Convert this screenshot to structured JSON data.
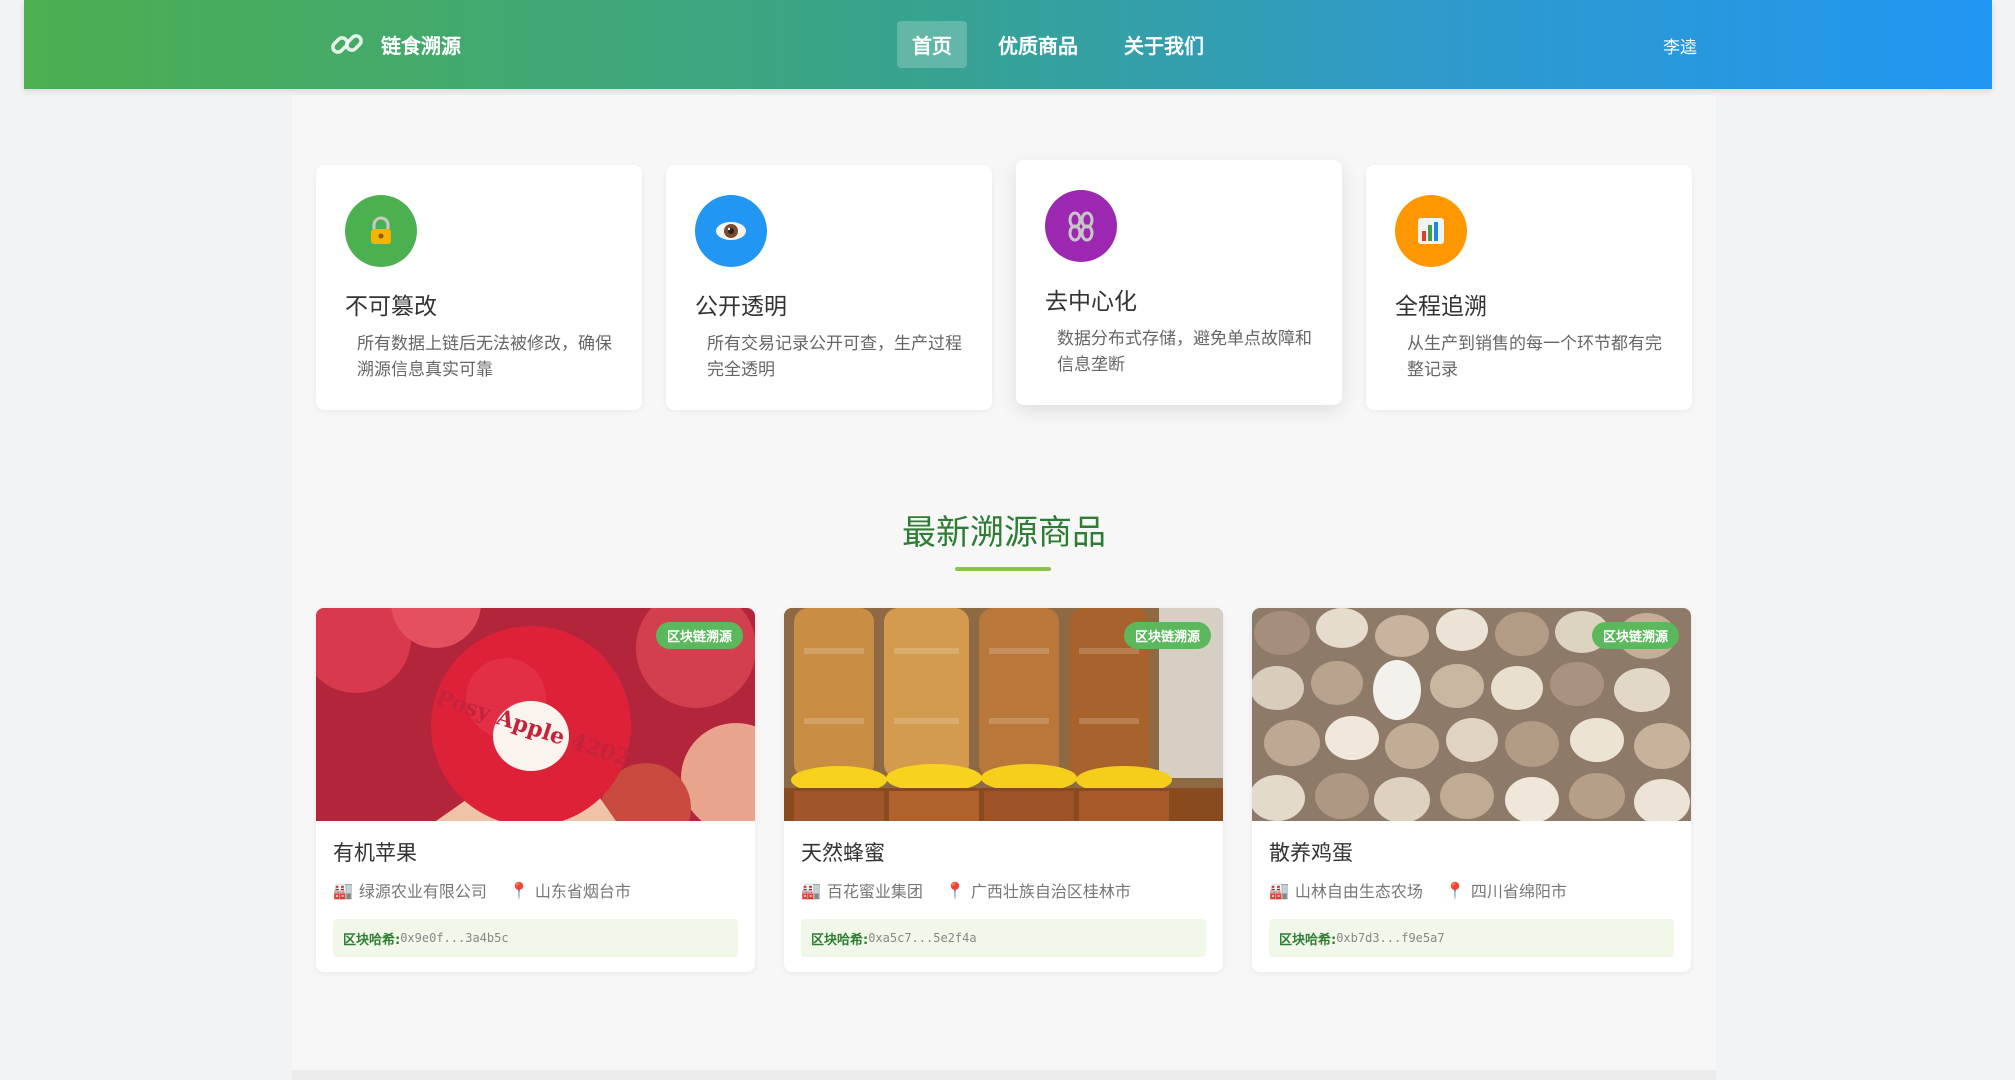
{
  "brand": {
    "name": "链食溯源",
    "icon": "link-icon"
  },
  "nav": {
    "items": [
      {
        "label": "首页",
        "active": true
      },
      {
        "label": "优质商品",
        "active": false
      },
      {
        "label": "关于我们",
        "active": false
      }
    ]
  },
  "user": {
    "name": "李逵"
  },
  "features": [
    {
      "icon": "lock-icon",
      "glyph": "🔒",
      "color": "#4caf50",
      "title": "不可篡改",
      "desc": "所有数据上链后无法被修改，确保溯源信息真实可靠"
    },
    {
      "icon": "eye-icon",
      "glyph": "👁",
      "color": "#2196f3",
      "title": "公开透明",
      "desc": "所有交易记录公开可查，生产过程完全透明"
    },
    {
      "icon": "chain-icon",
      "glyph": "⛓",
      "color": "#9c27b0",
      "title": "去中心化",
      "desc": "数据分布式存储，避免单点故障和信息垄断"
    },
    {
      "icon": "chart-icon",
      "glyph": "📊",
      "color": "#ff9800",
      "title": "全程追溯",
      "desc": "从生产到销售的每一个环节都有完整记录"
    }
  ],
  "section": {
    "title": "最新溯源商品"
  },
  "products": [
    {
      "name": "有机苹果",
      "badge": "区块链溯源",
      "company": "绿源农业有限公司",
      "location": "山东省烟台市",
      "hash_label": "区块哈希:",
      "hash": "0x9e0f...3a4b5c",
      "sticker": "Posy Apple 4202"
    },
    {
      "name": "天然蜂蜜",
      "badge": "区块链溯源",
      "company": "百花蜜业集团",
      "location": "广西壮族自治区桂林市",
      "hash_label": "区块哈希:",
      "hash": "0xa5c7...5e2f4a"
    },
    {
      "name": "散养鸡蛋",
      "badge": "区块链溯源",
      "company": "山林自由生态农场",
      "location": "四川省绵阳市",
      "hash_label": "区块哈希:",
      "hash": "0xb7d3...f9e5a7"
    }
  ],
  "icons": {
    "factory": "factory-icon",
    "pin": "pin-icon"
  }
}
